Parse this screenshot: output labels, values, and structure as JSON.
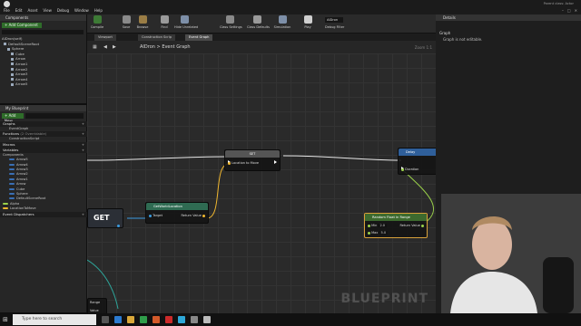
{
  "menubar": {
    "items": [
      "File",
      "Edit",
      "Asset",
      "View",
      "Debug",
      "Window",
      "Help"
    ],
    "parent_class": "Parent class: Actor"
  },
  "components": {
    "tab": "Components",
    "add_label": "+ Add Component",
    "tree": [
      "AIDron(self)",
      "DefaultSceneRoot",
      "Sphere",
      "Cube",
      "Arrow",
      "Arrow1",
      "Arrow2",
      "Arrow3",
      "Arrow4",
      "Arrow5"
    ]
  },
  "my_blueprint": {
    "tab": "My Blueprint",
    "add_label": "+ Add New",
    "graphs_label": "Graphs",
    "event_graph": "EventGraph",
    "functions_label": "Functions",
    "functions_count": "(2 Overridable)",
    "construction_script": "ConstructionScript",
    "macros_label": "Macros",
    "variables_label": "Variables",
    "components_label": "Components",
    "variables": [
      {
        "name": "Arrow5",
        "color": "#3a6fb5"
      },
      {
        "name": "Arrow4",
        "color": "#3a6fb5"
      },
      {
        "name": "Arrow3",
        "color": "#3a6fb5"
      },
      {
        "name": "Arrow2",
        "color": "#3a6fb5"
      },
      {
        "name": "Arrow1",
        "color": "#3a6fb5"
      },
      {
        "name": "Arrow",
        "color": "#3a6fb5"
      },
      {
        "name": "Cube",
        "color": "#3a6fb5"
      },
      {
        "name": "Sphere",
        "color": "#3a6fb5"
      },
      {
        "name": "DefaultSceneRoot",
        "color": "#3a6fb5"
      }
    ],
    "extra_vars": [
      {
        "name": "Alpha",
        "color": "#9bd24a"
      },
      {
        "name": "LocationToMove",
        "color": "#f0b72f"
      }
    ],
    "event_dispatchers": "Event Dispatchers"
  },
  "toolbar": {
    "buttons": [
      {
        "label": "Compile",
        "icon": "compile-icon",
        "color": "#3d7a35"
      },
      {
        "label": "Save",
        "icon": "save-icon",
        "color": "#8a8a8a"
      },
      {
        "label": "Browse",
        "icon": "browse-icon",
        "color": "#9a7d45"
      },
      {
        "label": "Find",
        "icon": "find-icon",
        "color": "#9a9a9a"
      },
      {
        "label": "Hide Unrelated",
        "icon": "hide-unrelated-icon",
        "color": "#7d8fa8"
      },
      {
        "label": "Class Settings",
        "icon": "class-settings-icon",
        "color": "#8a8a8a"
      },
      {
        "label": "Class Defaults",
        "icon": "class-defaults-icon",
        "color": "#9a9a9a"
      },
      {
        "label": "Simulation",
        "icon": "simulation-icon",
        "color": "#7d8fa8"
      },
      {
        "label": "Play",
        "icon": "play-icon",
        "color": "#cfcfcf"
      }
    ],
    "debug_select": "AIDron",
    "debug_filter": "Debug Filter"
  },
  "graph_tabs": [
    "Viewport",
    "Construction Scrip",
    "Event Graph"
  ],
  "breadcrumb": {
    "root": "AIDron",
    "sep": ">",
    "page": "Event Graph"
  },
  "zoom": "Zoom 1:1",
  "nodes": {
    "set": {
      "title": "SET",
      "pin": "Location to Move",
      "color": "#4a4a4a"
    },
    "get_world": {
      "title": "GetWorldLocation",
      "subtitle": "Target is Scene Component",
      "target": "Target",
      "ret": "Return Value",
      "color": "#3a7a5e"
    },
    "get": {
      "title": "GET"
    },
    "delay": {
      "title": "Delay",
      "completed": "Co",
      "duration": "Duration",
      "color": "#3f74b5"
    },
    "random_float": {
      "title": "Random Float in Range",
      "min": "Min",
      "min_val": "2.0",
      "max": "Max",
      "max_val": "5.0",
      "ret": "Return Value",
      "color": "#4a7a3a"
    },
    "bottom_node": {
      "title": "Range",
      "pin": "Value"
    }
  },
  "watermark": "BLUEPRINT",
  "details": {
    "tab": "Details",
    "graph_label": "Graph",
    "note": "Graph is not editable."
  },
  "taskbar": {
    "search_placeholder": "Type here to search"
  }
}
